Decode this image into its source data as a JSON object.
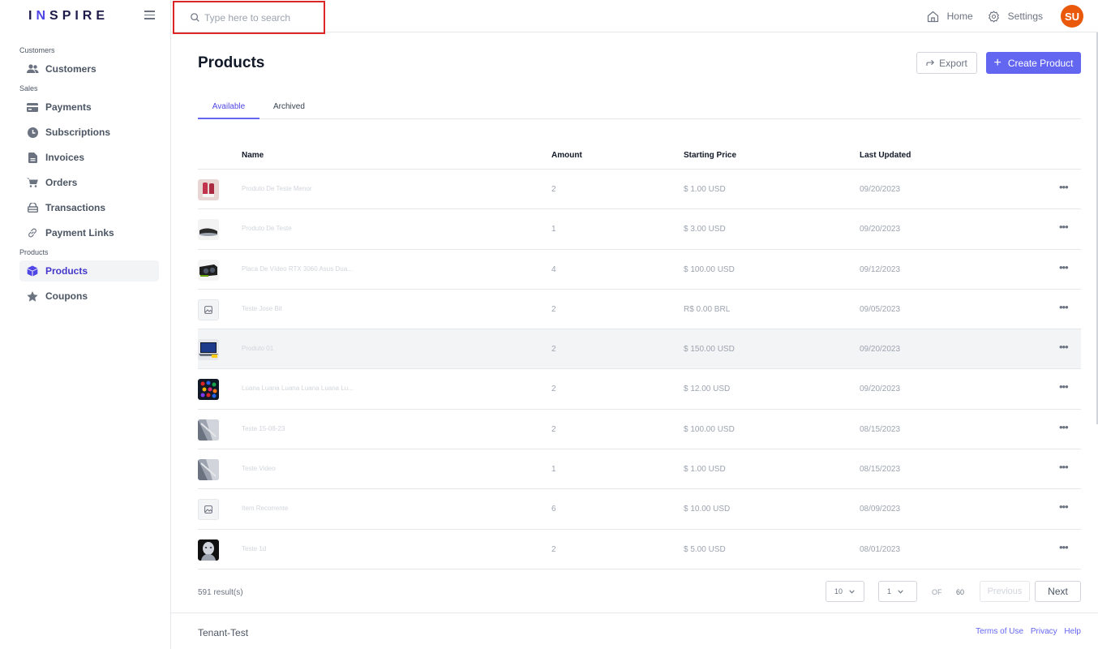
{
  "brand": {
    "prefix": "I",
    "accent": "N",
    "rest": "SPIRE"
  },
  "search": {
    "placeholder": "Type here to search"
  },
  "topnav": {
    "home": "Home",
    "settings": "Settings",
    "avatar": "SU"
  },
  "sidebar": {
    "sections": [
      "Customers",
      "Sales",
      "Products"
    ],
    "items": [
      {
        "label": "Customers",
        "icon": "users-icon"
      },
      {
        "label": "Payments",
        "icon": "card-icon"
      },
      {
        "label": "Subscriptions",
        "icon": "clock-icon"
      },
      {
        "label": "Invoices",
        "icon": "file-icon"
      },
      {
        "label": "Orders",
        "icon": "cart-icon"
      },
      {
        "label": "Transactions",
        "icon": "lock-icon"
      },
      {
        "label": "Payment Links",
        "icon": "link-icon"
      },
      {
        "label": "Products",
        "icon": "box-icon"
      },
      {
        "label": "Coupons",
        "icon": "star-icon"
      }
    ]
  },
  "page": {
    "title": "Products",
    "export_label": "Export",
    "create_label": "Create Product"
  },
  "tabs": [
    "Available",
    "Archived"
  ],
  "table": {
    "headers": [
      "Name",
      "Amount",
      "Starting Price",
      "Last Updated"
    ],
    "rows": [
      {
        "name": "Produto De Teste Menor",
        "amount": "2",
        "price": "$ 1.00 USD",
        "date": "09/20/2023"
      },
      {
        "name": "Produto De Teste",
        "amount": "1",
        "price": "$ 3.00 USD",
        "date": "09/20/2023"
      },
      {
        "name": "Placa De Vídeo RTX 3060 Asus Dua...",
        "amount": "4",
        "price": "$ 100.00 USD",
        "date": "09/12/2023"
      },
      {
        "name": "Teste Jose Bit",
        "amount": "2",
        "price": "R$ 0.00 BRL",
        "date": "09/05/2023"
      },
      {
        "name": "Produto 01",
        "amount": "2",
        "price": "$ 150.00 USD",
        "date": "09/20/2023"
      },
      {
        "name": "Luana Luana Luana Luana Luana Lu...",
        "amount": "2",
        "price": "$ 12.00 USD",
        "date": "09/20/2023"
      },
      {
        "name": "Teste 15-08-23",
        "amount": "2",
        "price": "$ 100.00 USD",
        "date": "08/15/2023"
      },
      {
        "name": "Teste Video",
        "amount": "1",
        "price": "$ 1.00 USD",
        "date": "08/15/2023"
      },
      {
        "name": "Item Recorrente",
        "amount": "6",
        "price": "$ 10.00 USD",
        "date": "08/09/2023"
      },
      {
        "name": "Teste 1d",
        "amount": "2",
        "price": "$ 5.00 USD",
        "date": "08/01/2023"
      }
    ],
    "menu_glyph": "•••"
  },
  "pager": {
    "results": "591 result(s)",
    "page_size": "10",
    "page": "1",
    "of_label": "OF",
    "total_pages": "60",
    "prev": "Previous",
    "next": "Next"
  },
  "footer": {
    "tenant": "Tenant-Test",
    "links": [
      "Terms of Use",
      "Privacy",
      "Help"
    ]
  },
  "colors": {
    "accent": "#6366f1",
    "avatar": "#ea580c",
    "highlight": "#dc2626"
  }
}
